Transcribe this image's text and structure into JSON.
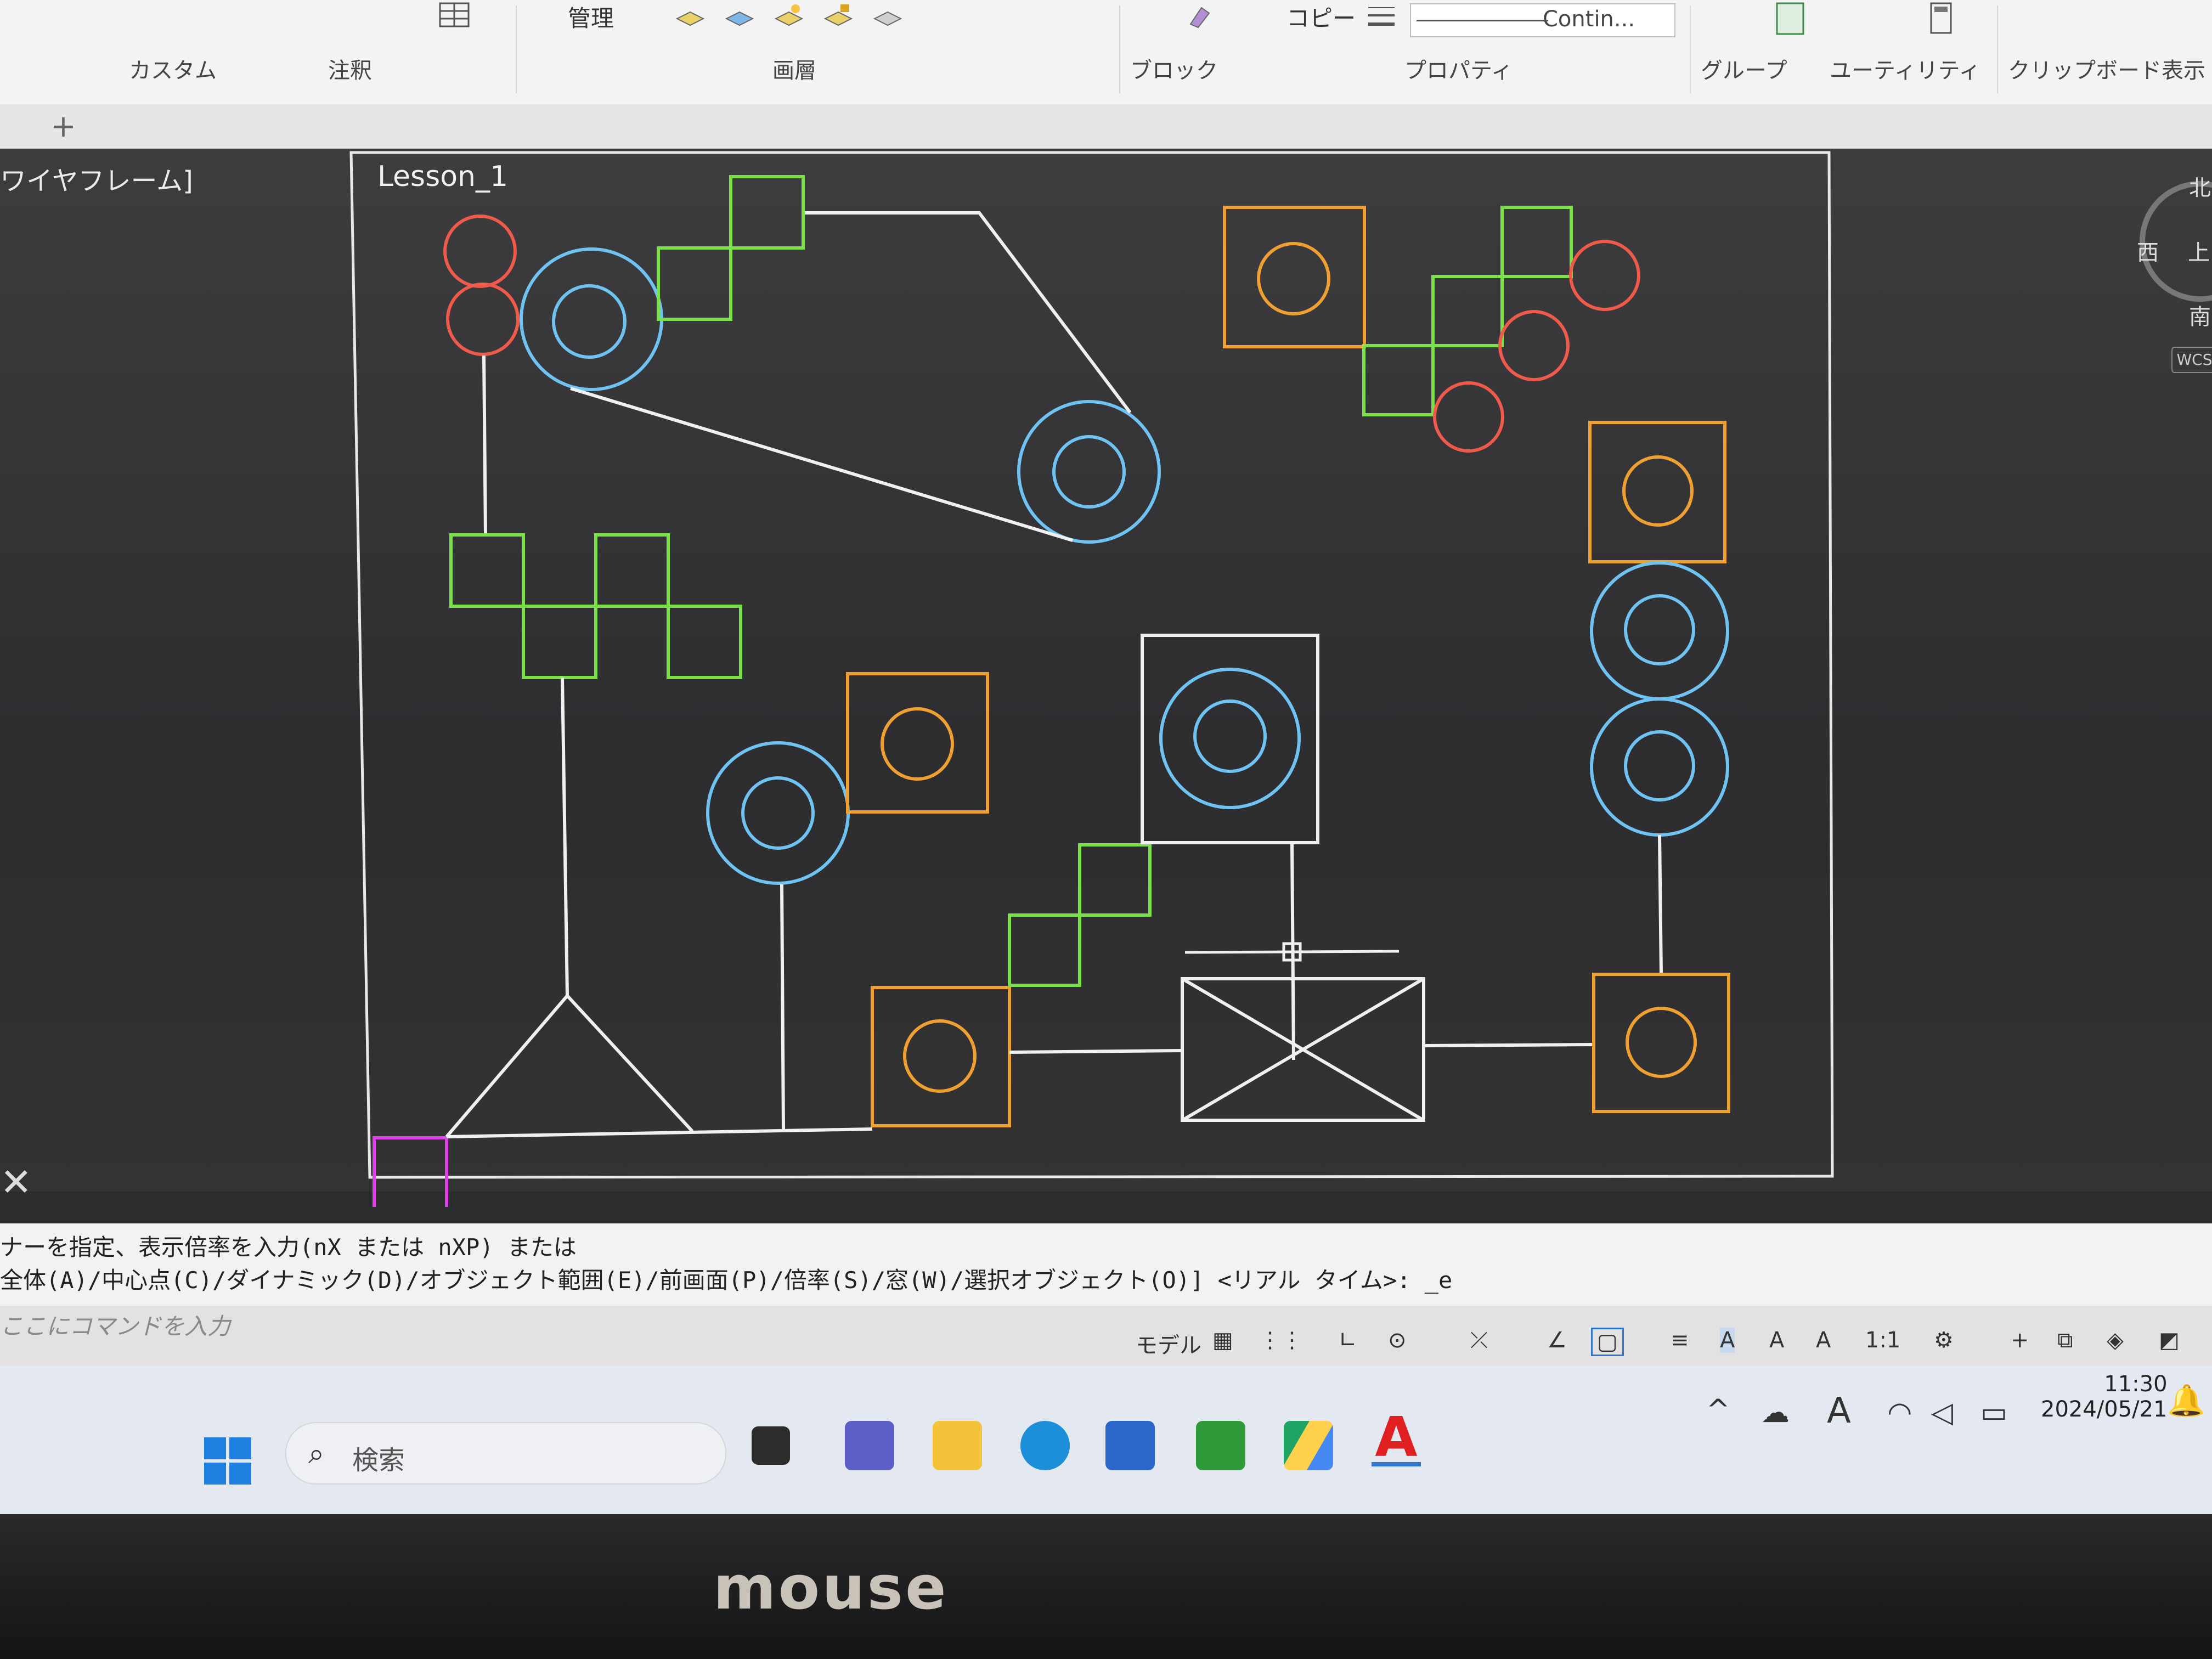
{
  "ribbon": {
    "top_labels": {
      "kanri": "管理",
      "copy": "コピー"
    },
    "panels": {
      "custom": "カスタム",
      "annotation": "注釈",
      "layer": "画層",
      "block": "ブロック",
      "properties": "プロパティ",
      "group": "グループ",
      "utilities": "ユーティリティ",
      "clipboard": "クリップボード",
      "view": "表示"
    },
    "linetype_value": "Contin..."
  },
  "tabs": {
    "new_tab": "+"
  },
  "viewport": {
    "label": "ワイヤフレーム]",
    "layout_title": "Lesson_1",
    "viewcube": {
      "north": "北",
      "west": "西",
      "south": "南",
      "top": "上"
    },
    "wcs": "WCS"
  },
  "command": {
    "line1": "ナーを指定、表示倍率を入力(nX または nXP) または",
    "line2": "全体(A)/中心点(C)/ダイナミック(D)/オブジェクト範囲(E)/前画面(P)/倍率(S)/窓(W)/選択オブジェクト(O)] <リアル タイム>:  _e",
    "input_placeholder": "ここにコマンドを入力"
  },
  "status": {
    "model": "モデル",
    "scale": "1:1"
  },
  "taskbar": {
    "search_placeholder": "検索",
    "time": "11:30",
    "date": "2024/05/21"
  },
  "bezel": {
    "brand": "mouse"
  },
  "colors": {
    "cad_white": "#f0f0f0",
    "cad_green": "#7ce04a",
    "cad_red": "#ef5a4a",
    "cad_blue": "#6ec3f2",
    "cad_orange": "#f0a030",
    "cad_magenta": "#e040e8"
  }
}
